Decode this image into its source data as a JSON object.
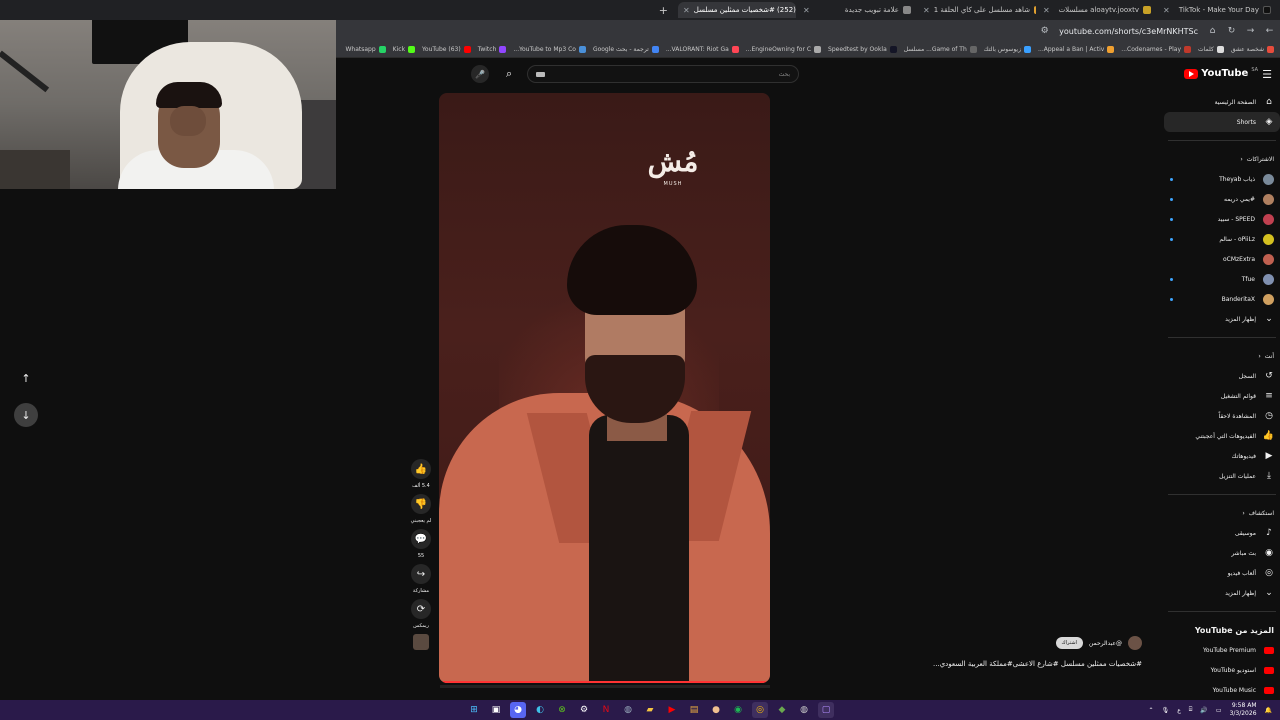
{
  "tabs": [
    {
      "title": "TikTok - Make Your Day",
      "color": "#111111",
      "active": false
    },
    {
      "title": "aloaytv.jooxtv مسلسلات",
      "color": "#c9a227",
      "active": false
    },
    {
      "title": "شاهد مسلسل على كاي الحلقة 1",
      "color": "#e0a030",
      "active": false
    },
    {
      "title": "علامة تبويب جديدة",
      "color": "#888888",
      "active": false
    },
    {
      "title": "(252) #شخصيات ممثلين مسلسل",
      "color": "#ff0000",
      "active": true
    }
  ],
  "address": {
    "url": "youtube.com/shorts/c3eMrNKHTSc"
  },
  "bookmarks": [
    {
      "label": "Whatsapp",
      "color": "#25d366"
    },
    {
      "label": "Kick",
      "color": "#53fc18"
    },
    {
      "label": "(63) YouTube",
      "color": "#ff0000"
    },
    {
      "label": "Twitch",
      "color": "#9146ff"
    },
    {
      "label": "YouTube to Mp3 Co...",
      "color": "#4a90d9"
    },
    {
      "label": "ترجمة - بحث Google",
      "color": "#4285f4"
    },
    {
      "label": "VALORANT: Riot Ga...",
      "color": "#ff4655"
    },
    {
      "label": "EngineOwning for C...",
      "color": "#aaaaaa"
    },
    {
      "label": "Speedtest by Ookla",
      "color": "#141526"
    },
    {
      "label": "Game of Th... مسلسل",
      "color": "#666666"
    },
    {
      "label": "زيوسوس بالتك",
      "color": "#3aa0ff"
    },
    {
      "label": "Appeal a Ban | Activ...",
      "color": "#f0a030"
    },
    {
      "label": "Codenames - Play...",
      "color": "#c0392b"
    },
    {
      "label": "كلمات",
      "color": "#dddddd"
    },
    {
      "label": "شخصة عشق",
      "color": "#e74c3c"
    }
  ],
  "search": {
    "placeholder": "بحث"
  },
  "logo": {
    "text": "YouTube",
    "region": "SA"
  },
  "video": {
    "brand_arabic": "مُش",
    "brand_latin": "MUSH",
    "channel_name": "@عبدالرحمن",
    "subscribe_label": "اشتراك",
    "caption": "#شخصيات ممثلين مسلسل #شارع الاعشى#مملكة العربية السعودي...",
    "progress": 1.0
  },
  "actions": [
    {
      "name": "like",
      "icon": "👍",
      "label": "5.4 ألف"
    },
    {
      "name": "dislike",
      "icon": "👎",
      "label": "لم يعجبني"
    },
    {
      "name": "comments",
      "icon": "💬",
      "label": "55"
    },
    {
      "name": "share",
      "icon": "↪",
      "label": "مشاركة"
    },
    {
      "name": "remix",
      "icon": "⟳",
      "label": "ريمكس"
    }
  ],
  "sidebar": {
    "main": [
      {
        "label": "الصفحة الرئيسية",
        "icon": "⌂"
      },
      {
        "label": "Shorts",
        "icon": "◈",
        "active": true
      }
    ],
    "subs_header": "الاشتراكات",
    "subs": [
      {
        "label": "ذياب Theyab",
        "color": "#7a8a9a",
        "dot": true
      },
      {
        "label": "#يمي دريمه",
        "color": "#b08060",
        "dot": true
      },
      {
        "label": "SPEED - سبيد",
        "color": "#c04050",
        "dot": true
      },
      {
        "label": "oPiiLz - سالم",
        "color": "#d4c020",
        "dot": true
      },
      {
        "label": "oCMzExtra",
        "color": "#c06050",
        "dot": false
      },
      {
        "label": "Tfue",
        "color": "#8090b0",
        "dot": true
      },
      {
        "label": "BanderitaX",
        "color": "#d0a060",
        "dot": true
      }
    ],
    "show_more": "إظهار المزيد",
    "you_header": "أنت",
    "you": [
      {
        "label": "السجل",
        "icon": "↺"
      },
      {
        "label": "قوائم التشغيل",
        "icon": "≡"
      },
      {
        "label": "المشاهدة لاحقاً",
        "icon": "◷"
      },
      {
        "label": "الفيديوهات التي أعجبتني",
        "icon": "👍"
      },
      {
        "label": "فيديوهاتك",
        "icon": "▶"
      },
      {
        "label": "عمليات التنزيل",
        "icon": "⤓"
      }
    ],
    "explore_header": "استكشاف",
    "explore": [
      {
        "label": "موسيقى",
        "icon": "♪"
      },
      {
        "label": "بث مباشر",
        "icon": "◉"
      },
      {
        "label": "ألعاب فيديو",
        "icon": "◎"
      }
    ],
    "show_more_2": "إظهار المزيد",
    "more_header": "المزيد من YouTube",
    "more": [
      {
        "label": "YouTube Premium"
      },
      {
        "label": "استوديو YouTube"
      },
      {
        "label": "YouTube Music"
      },
      {
        "label": "YouTube Kids"
      }
    ]
  },
  "taskbar": {
    "time": "9:58 AM",
    "date": "3/3/2026",
    "lang": "ع"
  }
}
